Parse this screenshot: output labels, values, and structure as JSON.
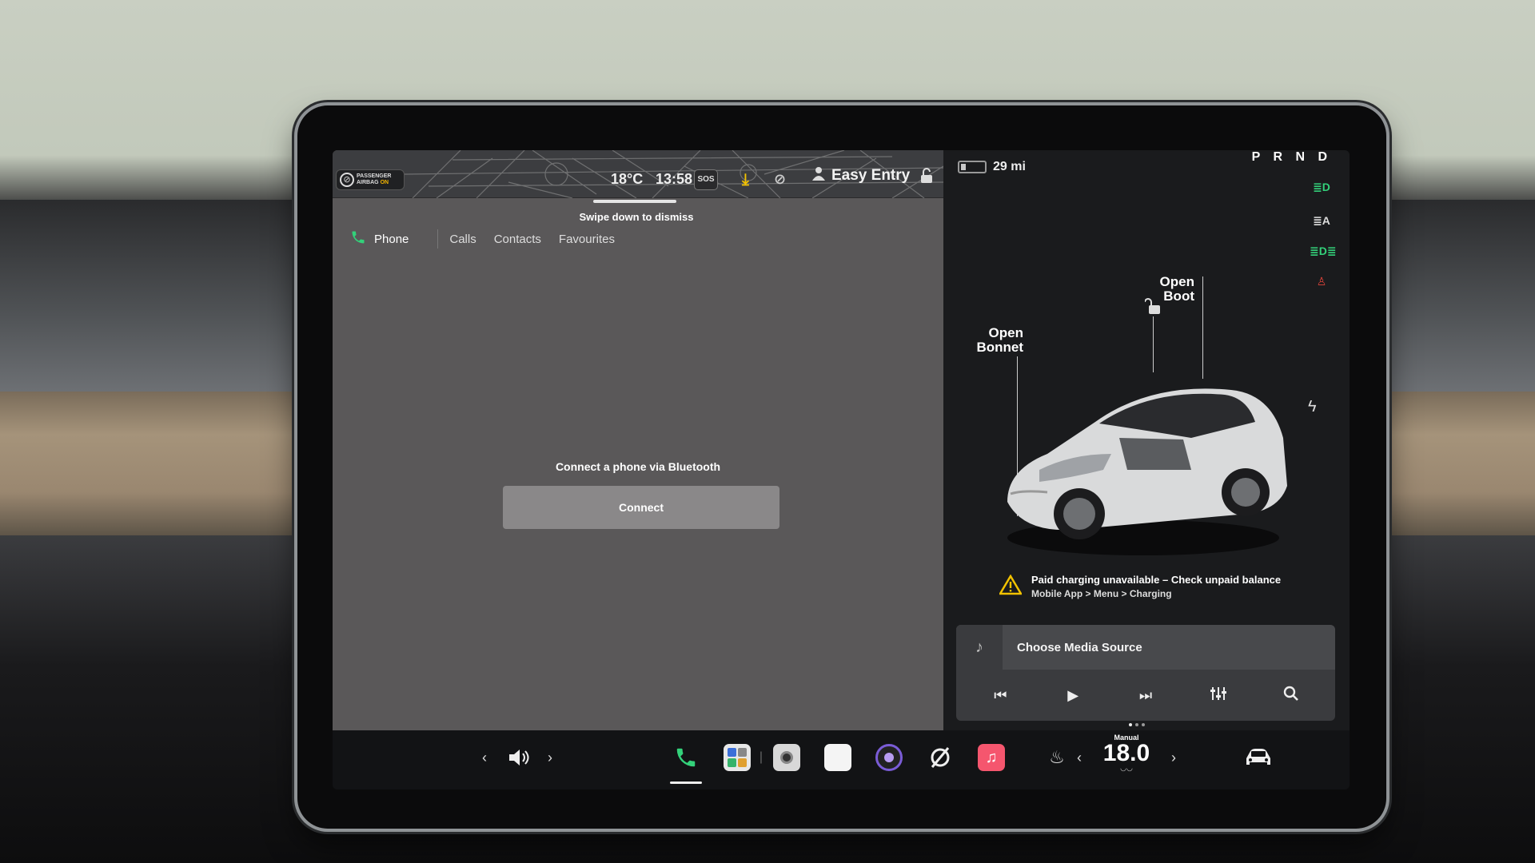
{
  "status_bar": {
    "airbag_line1": "PASSENGER",
    "airbag_line2_prefix": "AIRBAG ",
    "airbag_line2_state": "ON",
    "temperature": "18°C",
    "time": "13:58",
    "sos": "SOS",
    "profile": "Easy Entry"
  },
  "swipe_hint": "Swipe down to dismiss",
  "phone_app": {
    "title": "Phone",
    "tabs": [
      "Calls",
      "Contacts",
      "Favourites"
    ],
    "prompt": "Connect a phone via Bluetooth",
    "connect_label": "Connect"
  },
  "vehicle": {
    "range": "29 mi",
    "battery_level": 0.22,
    "gear": "P R N D",
    "open_bonnet_line1": "Open",
    "open_bonnet_line2": "Bonnet",
    "open_boot_line1": "Open",
    "open_boot_line2": "Boot",
    "warning_line1": "Paid charging unavailable – Check unpaid balance",
    "warning_line2": "Mobile App > Menu > Charging"
  },
  "media": {
    "source_label": "Choose Media Source"
  },
  "climate": {
    "mode": "Manual",
    "temperature": "18.0"
  },
  "colors": {
    "accent_green": "#33d17a",
    "warning_yellow": "#f2c200",
    "seatbelt_red": "#e0443a",
    "music_pink": "#f5566e"
  }
}
